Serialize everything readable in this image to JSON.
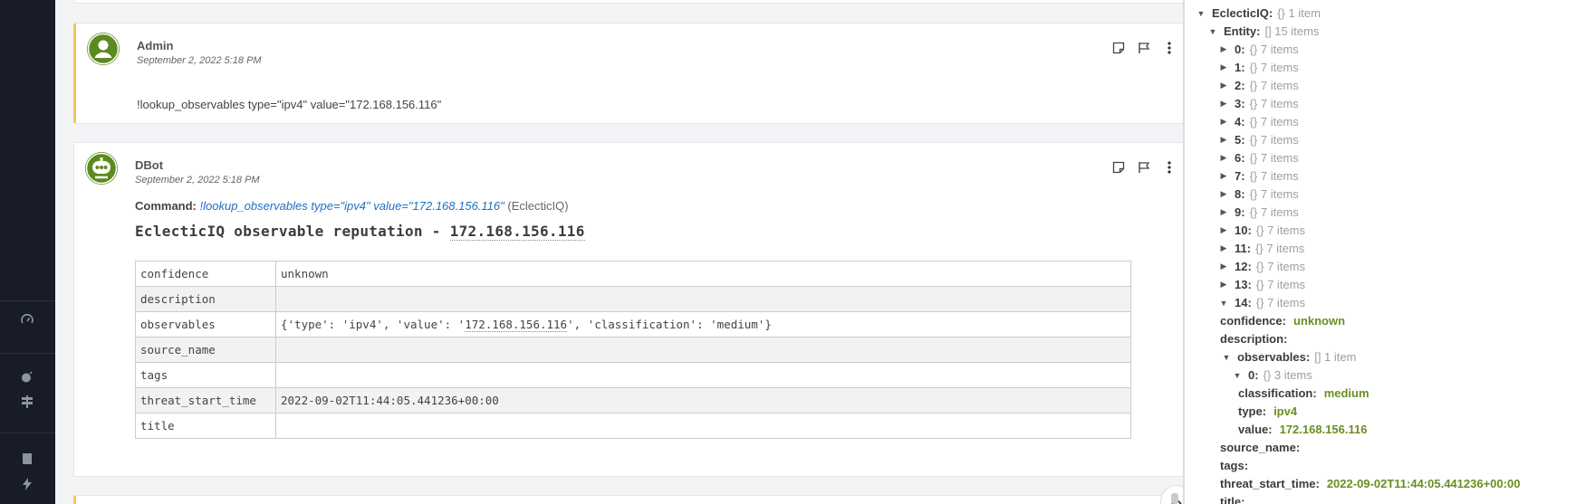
{
  "feed": {
    "entry1": {
      "user": "Admin",
      "time": "September 2, 2022 5:18 PM",
      "message": "!lookup_observables type=\"ipv4\" value=\"172.168.156.116\""
    },
    "entry2": {
      "user": "DBot",
      "time": "September 2, 2022 5:18 PM",
      "command_label": "Command:",
      "command_text": "!lookup_observables type=\"ipv4\" value=\"172.168.156.116\"",
      "integration": "(EclecticIQ)",
      "title_prefix": "EclecticIQ observable reputation - ",
      "title_ip": "172.168.156.116",
      "table": [
        {
          "key": "confidence",
          "value": "unknown"
        },
        {
          "key": "description",
          "value": ""
        },
        {
          "key": "observables",
          "value_pre": "{'type': 'ipv4', 'value': '",
          "value_ip": "172.168.156.116",
          "value_post": "', 'classification': 'medium'}"
        },
        {
          "key": "source_name",
          "value": ""
        },
        {
          "key": "tags",
          "value": ""
        },
        {
          "key": "threat_start_time",
          "value": "2022-09-02T11:44:05.441236+00:00"
        },
        {
          "key": "title",
          "value": ""
        }
      ]
    }
  },
  "context": {
    "root": {
      "key": "EclecticIQ:",
      "meta": "{} 1 item"
    },
    "entity": {
      "key": "Entity:",
      "meta": "[] 15 items"
    },
    "items": [
      {
        "key": "0:",
        "meta": "{} 7 items"
      },
      {
        "key": "1:",
        "meta": "{} 7 items"
      },
      {
        "key": "2:",
        "meta": "{} 7 items"
      },
      {
        "key": "3:",
        "meta": "{} 7 items"
      },
      {
        "key": "4:",
        "meta": "{} 7 items"
      },
      {
        "key": "5:",
        "meta": "{} 7 items"
      },
      {
        "key": "6:",
        "meta": "{} 7 items"
      },
      {
        "key": "7:",
        "meta": "{} 7 items"
      },
      {
        "key": "8:",
        "meta": "{} 7 items"
      },
      {
        "key": "9:",
        "meta": "{} 7 items"
      },
      {
        "key": "10:",
        "meta": "{} 7 items"
      },
      {
        "key": "11:",
        "meta": "{} 7 items"
      },
      {
        "key": "12:",
        "meta": "{} 7 items"
      },
      {
        "key": "13:",
        "meta": "{} 7 items"
      },
      {
        "key": "14:",
        "meta": "{} 7 items"
      }
    ],
    "expanded": {
      "confidence": {
        "key": "confidence:",
        "value": "unknown"
      },
      "description": {
        "key": "description:"
      },
      "observables": {
        "key": "observables:",
        "meta": "[] 1 item"
      },
      "obs0": {
        "key": "0:",
        "meta": "{} 3 items"
      },
      "classification": {
        "key": "classification:",
        "value": "medium"
      },
      "type": {
        "key": "type:",
        "value": "ipv4"
      },
      "value": {
        "key": "value:",
        "value": "172.168.156.116"
      },
      "source_name": {
        "key": "source_name:"
      },
      "tags": {
        "key": "tags:"
      },
      "threat_start_time": {
        "key": "threat_start_time:",
        "value": "2022-09-02T11:44:05.441236+00:00"
      },
      "title": {
        "key": "title:"
      }
    }
  }
}
